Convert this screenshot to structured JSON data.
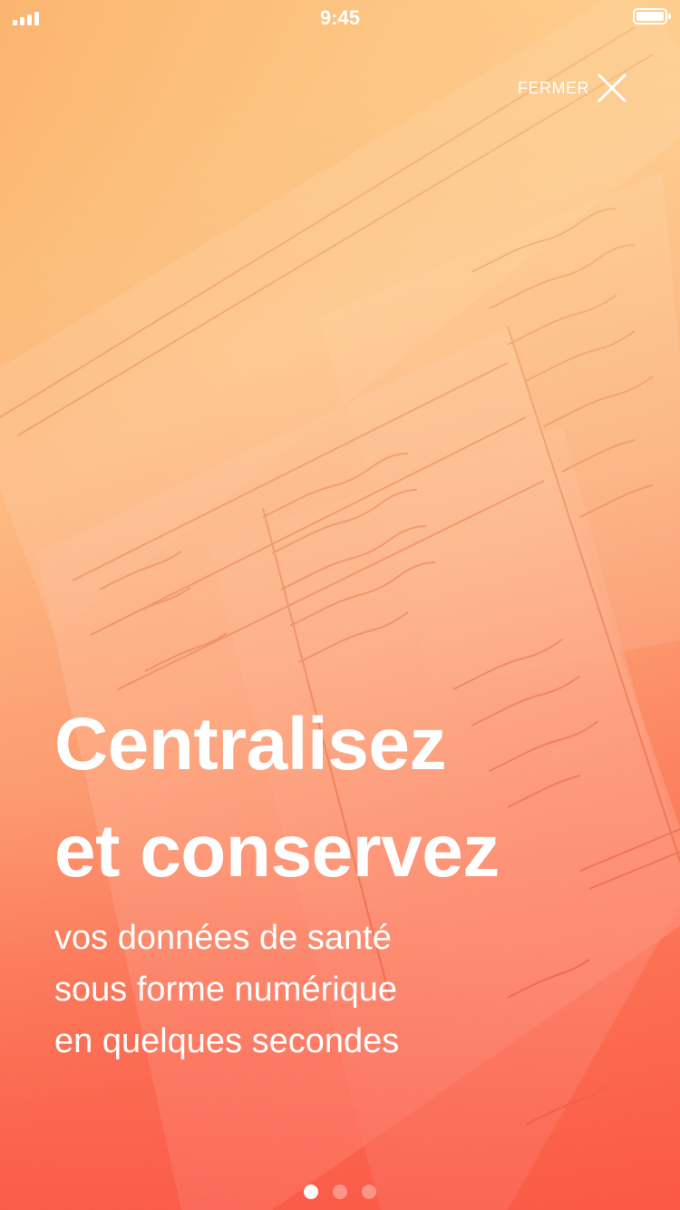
{
  "status_bar": {
    "time": "9:45"
  },
  "close": {
    "label": "FERMER",
    "icon": "close-icon"
  },
  "onboarding": {
    "headline_lines": [
      "Centralisez",
      "et conservez"
    ],
    "subtitle_lines": [
      "vos données de santé",
      "sous forme numérique",
      "en quelques secondes"
    ],
    "page_count": 3,
    "current_page": 1
  },
  "colors": {
    "gradient_top": "#f9a35a",
    "gradient_bottom": "#fa5a46",
    "text": "#ffffff"
  }
}
